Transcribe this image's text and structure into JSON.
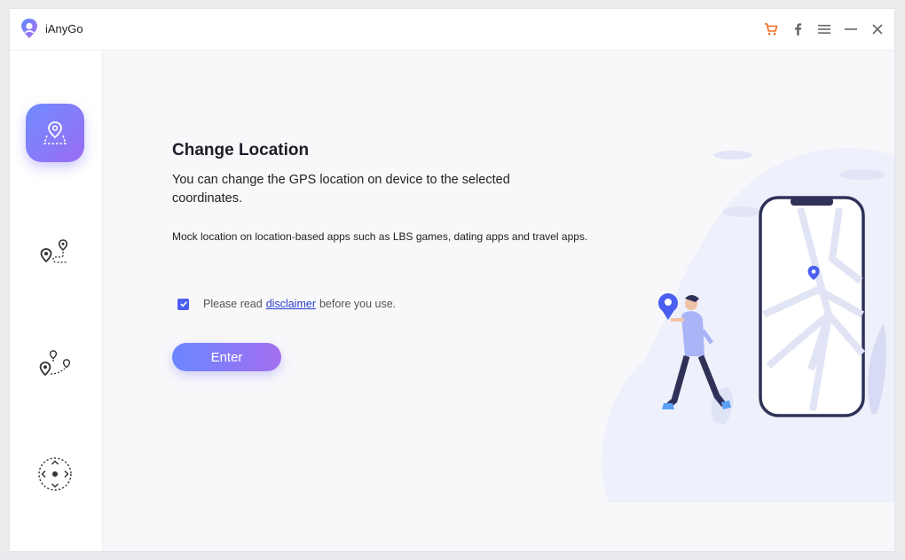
{
  "app": {
    "title": "iAnyGo"
  },
  "titlebar": {
    "icons": [
      "cart-icon",
      "facebook-icon",
      "menu-icon",
      "minimize-icon",
      "close-icon"
    ],
    "cart_color": "#f06a1f"
  },
  "sidebar": {
    "modes": [
      {
        "icon": "change-location-icon",
        "active": true
      },
      {
        "icon": "two-spot-movement-icon",
        "active": false
      },
      {
        "icon": "multi-spot-movement-icon",
        "active": false
      },
      {
        "icon": "joystick-movement-icon",
        "active": false
      }
    ]
  },
  "main": {
    "title": "Change Location",
    "description": "You can change the GPS location on device to the selected coordinates.",
    "note": "Mock location on location-based apps such as LBS games, dating apps and travel apps.",
    "agree": {
      "checked": true,
      "prefix": "Please read",
      "link": "disclaimer",
      "suffix": "before you use."
    },
    "enter_label": "Enter"
  },
  "colors": {
    "accent_start": "#6a86ff",
    "accent_end": "#a36ff0",
    "link": "#2b3fcf"
  }
}
